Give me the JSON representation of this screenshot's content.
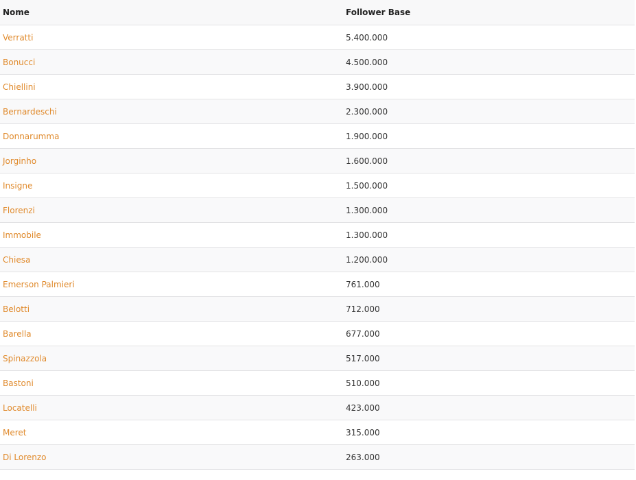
{
  "table": {
    "headers": {
      "name": "Nome",
      "followers": "Follower Base"
    },
    "rows": [
      {
        "name": "Verratti",
        "followers": "5.400.000"
      },
      {
        "name": "Bonucci",
        "followers": "4.500.000"
      },
      {
        "name": "Chiellini",
        "followers": "3.900.000"
      },
      {
        "name": "Bernardeschi",
        "followers": "2.300.000"
      },
      {
        "name": "Donnarumma",
        "followers": "1.900.000"
      },
      {
        "name": "Jorginho",
        "followers": "1.600.000"
      },
      {
        "name": "Insigne",
        "followers": "1.500.000"
      },
      {
        "name": "Florenzi",
        "followers": "1.300.000"
      },
      {
        "name": "Immobile",
        "followers": "1.300.000"
      },
      {
        "name": "Chiesa",
        "followers": "1.200.000"
      },
      {
        "name": "Emerson Palmieri",
        "followers": "761.000"
      },
      {
        "name": "Belotti",
        "followers": "712.000"
      },
      {
        "name": "Barella",
        "followers": "677.000"
      },
      {
        "name": "Spinazzola",
        "followers": "517.000"
      },
      {
        "name": "Bastoni",
        "followers": "510.000"
      },
      {
        "name": "Locatelli",
        "followers": "423.000"
      },
      {
        "name": "Meret",
        "followers": "315.000"
      },
      {
        "name": "Di Lorenzo",
        "followers": "263.000"
      }
    ]
  },
  "colors": {
    "link": "#e08a2c",
    "header_bg": "#f8f8f9",
    "row_alt_bg": "#f9f9fa",
    "border": "#e2e2e4"
  }
}
